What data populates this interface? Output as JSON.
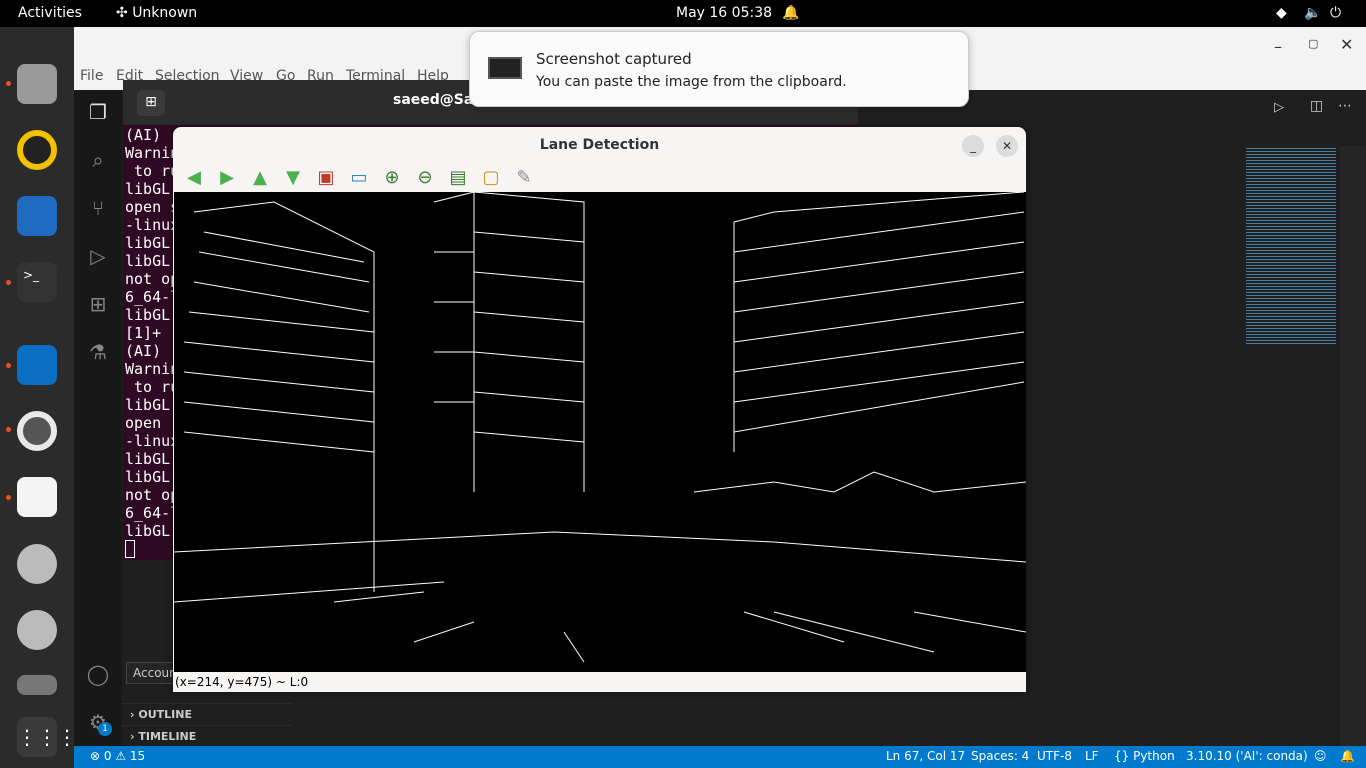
{
  "topbar": {
    "activities": "Activities",
    "app": "Unknown",
    "clock": "May 16  05:38"
  },
  "notification": {
    "title": "Screenshot captured",
    "body": "You can paste the image from the clipboard."
  },
  "vscode": {
    "menu": [
      "File",
      "Edit",
      "Selection",
      "View",
      "Go",
      "Run",
      "Terminal",
      "Help"
    ],
    "status": {
      "problems": "⊗ 0 ⚠ 15",
      "position": "Ln 67, Col 17",
      "spaces": "Spaces: 4",
      "encoding": "UTF-8",
      "eol": "LF",
      "language": "{} Python",
      "interpreter": "3.10.10 ('AI': conda)"
    },
    "sidebar": {
      "outline": "OUTLINE",
      "timeline": "TIMELINE",
      "accounts_tooltip": "Accoun",
      "badge": "1"
    }
  },
  "terminal": {
    "title": "saeed@Sae",
    "lines": "(AI) \nWarnin\n to ru\nlibGL\nopen s\n-linux\nlibGL\nlibGL\nnot op\n6_64-l\nlibGL\n[1]+\n(AI) \nWarnin\n to ru\nlibGL\nopen \n-linux\nlibGL\nlibGL\nnot op\n6_64-l\nlibGL"
  },
  "lane": {
    "title": "Lane Detection",
    "status": "(x=214, y=475) ~ L:0"
  },
  "colors": {
    "accent": "#007acc",
    "ubuntu_orange": "#e95420"
  }
}
